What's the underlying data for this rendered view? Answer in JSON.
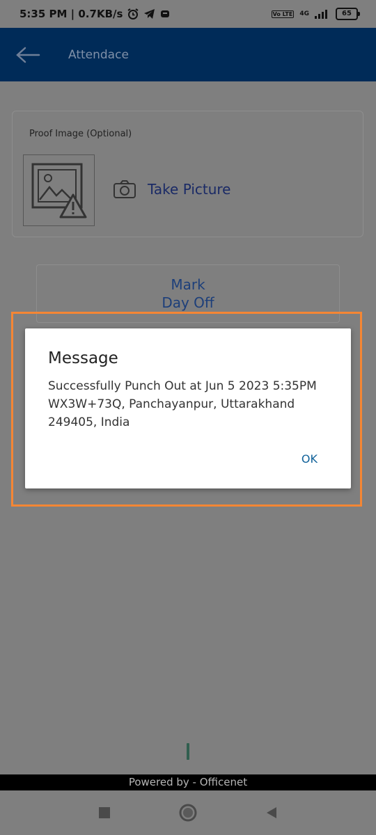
{
  "status_bar": {
    "time_speed": "5:35 PM | 0.7KB/s",
    "icons": [
      "alarm-icon",
      "telegram-icon",
      "notification-icon"
    ],
    "volte": "Vo LTE",
    "network": "4G",
    "battery": "65"
  },
  "app_bar": {
    "back_icon": "arrow-left-icon",
    "title": "Attendace"
  },
  "proof_card": {
    "label": "Proof Image (Optional)",
    "image_placeholder_icon": "broken-image-icon",
    "take_picture_icon": "camera-icon",
    "take_picture_label": "Take Picture"
  },
  "day_off": {
    "line1": "Mark",
    "line2": "Day Off"
  },
  "dialog": {
    "title": "Message",
    "message": "Successfully Punch Out at Jun  5 2023 5:35PM WX3W+73Q, Panchayanpur, Uttarakhand 249405, India",
    "ok_label": "OK"
  },
  "footer": {
    "powered_by": "Powered by - Officenet"
  },
  "colors": {
    "app_bar": "#002b58",
    "overlay": "#7f7f7f",
    "highlight": "#f58634",
    "ok_button": "#11629a"
  }
}
